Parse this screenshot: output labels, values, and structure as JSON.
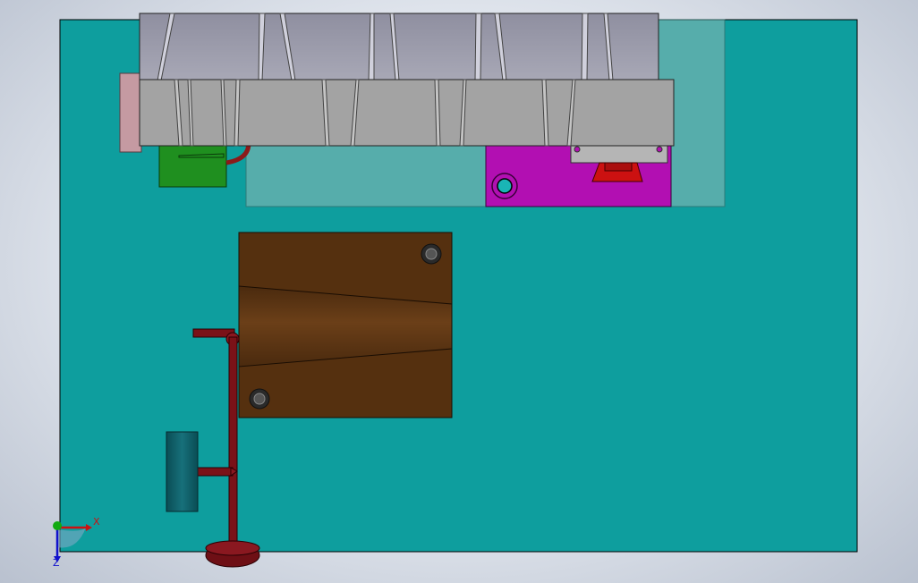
{
  "viewport": {
    "background": "#dfe4ec",
    "plate_color": "#0e9e9e",
    "translucent_block_color": "#6fb3b0",
    "grey_part_color": "#a3a3a3",
    "grey_top_color": "#9a9aa8",
    "magenta_block_color": "#b20fb2",
    "brown_block_color": "#5a3412",
    "handle_color": "#7a1218",
    "green_part_color": "#1f8f1f",
    "pink_part_color": "#c59aa2"
  },
  "triad": {
    "x_label": "X",
    "z_label": "Z",
    "x_color": "#cc1111",
    "y_color": "#11aa11",
    "z_color": "#1111cc"
  }
}
